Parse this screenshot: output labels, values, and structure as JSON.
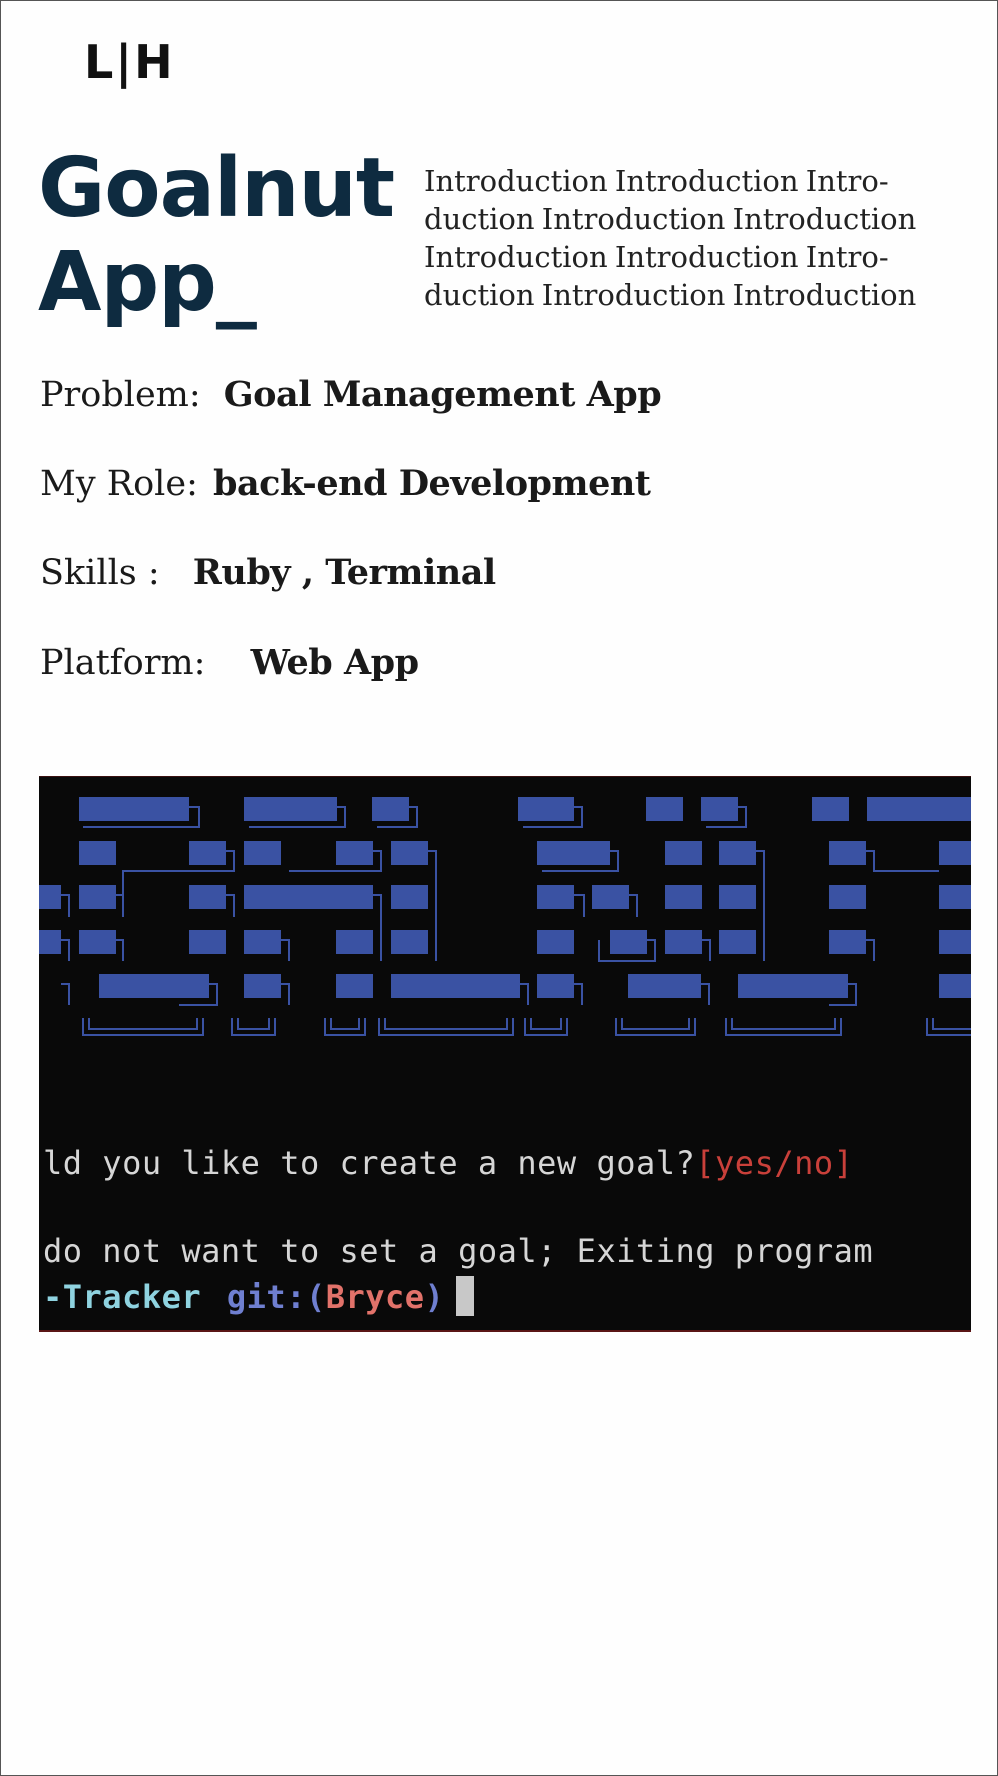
{
  "logo": {
    "text": "L|H"
  },
  "project": {
    "title_lines": [
      "Goalnut",
      "App_"
    ],
    "intro_lines": [
      "Introduction Introduction Intro-",
      "duction Introduction Introduction",
      "Introduction Introduction Intro-",
      "duction Introduction Introduction"
    ]
  },
  "details": {
    "problem": {
      "label": "Problem:",
      "value": "Goal Management App"
    },
    "role": {
      "label": "My Role:",
      "value": "back-end Development"
    },
    "skills": {
      "label": "Skills :",
      "value": "Ruby , Terminal"
    },
    "platform": {
      "label": "Platform:",
      "value": "Web App"
    }
  },
  "terminal": {
    "banner_color": "#3a52a3",
    "background": "#090909",
    "prompt_question": "ld you like to create a new goal?",
    "prompt_options": "[yes/no]",
    "exit_message": "do not want to set a goal; Exiting program",
    "shell_dir": "-Tracker",
    "git_label": "git:(",
    "git_branch": "Bryce",
    "git_close": ")",
    "partial_char": "."
  }
}
